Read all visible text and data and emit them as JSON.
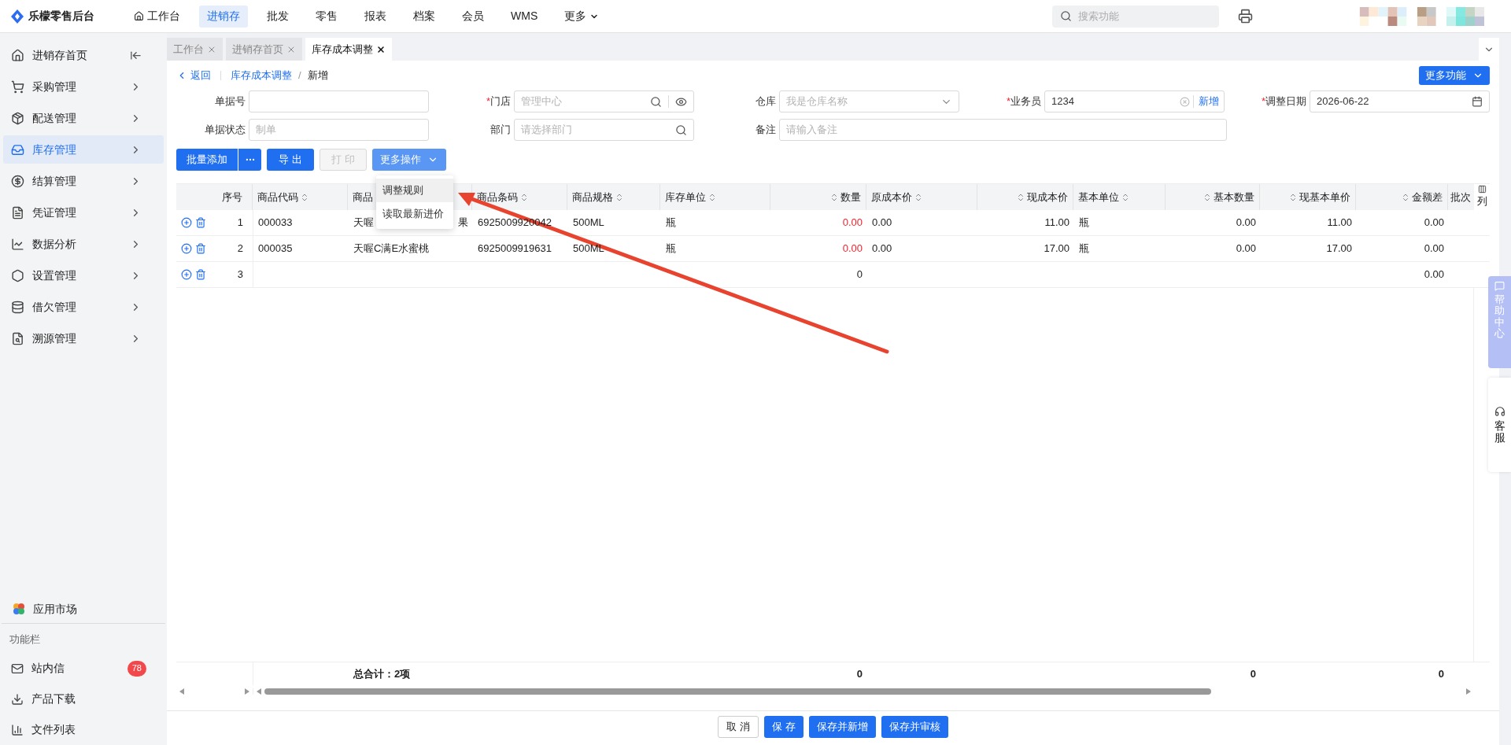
{
  "app": {
    "name": "乐檬零售后台"
  },
  "nav": [
    {
      "label": "工作台",
      "selected": false,
      "has_menu": false
    },
    {
      "label": "进销存",
      "selected": true,
      "has_menu": false
    },
    {
      "label": "批发",
      "selected": false,
      "has_menu": false
    },
    {
      "label": "零售",
      "selected": false,
      "has_menu": false
    },
    {
      "label": "报表",
      "selected": false,
      "has_menu": false
    },
    {
      "label": "档案",
      "selected": false,
      "has_menu": false
    },
    {
      "label": "会员",
      "selected": false,
      "has_menu": false
    },
    {
      "label": "WMS",
      "selected": false,
      "has_menu": false
    },
    {
      "label": "更多",
      "selected": false,
      "has_menu": true
    }
  ],
  "search": {
    "placeholder": "搜索功能"
  },
  "sidebar": {
    "items": [
      {
        "label": "进销存首页",
        "selected": false,
        "has_arrow": false
      },
      {
        "label": "采购管理",
        "selected": false,
        "has_arrow": true
      },
      {
        "label": "配送管理",
        "selected": false,
        "has_arrow": true
      },
      {
        "label": "库存管理",
        "selected": true,
        "has_arrow": true
      },
      {
        "label": "结算管理",
        "selected": false,
        "has_arrow": true
      },
      {
        "label": "凭证管理",
        "selected": false,
        "has_arrow": true
      },
      {
        "label": "数据分析",
        "selected": false,
        "has_arrow": true
      },
      {
        "label": "设置管理",
        "selected": false,
        "has_arrow": true
      },
      {
        "label": "借欠管理",
        "selected": false,
        "has_arrow": true
      },
      {
        "label": "溯源管理",
        "selected": false,
        "has_arrow": true
      }
    ],
    "app_market": "应用市场",
    "function_bar": {
      "title": "功能栏",
      "items": [
        {
          "label": "站内信",
          "badge": "78"
        },
        {
          "label": "产品下载"
        },
        {
          "label": "文件列表"
        }
      ]
    }
  },
  "tabs": [
    {
      "label": "工作台",
      "selected": false
    },
    {
      "label": "进销存首页",
      "selected": false
    },
    {
      "label": "库存成本调整",
      "selected": true
    }
  ],
  "breadcrumb": {
    "back": "返回",
    "separator": "/",
    "items": [
      "库存成本调整",
      "新增"
    ]
  },
  "more_functions": "更多功能",
  "form": {
    "required_mark": "*",
    "rows": [
      [
        {
          "label": "单据号",
          "required": false,
          "kind": "text"
        },
        {
          "label": "门店",
          "required": true,
          "kind": "search_eye",
          "placeholder": "管理中心"
        },
        {
          "label": "仓库",
          "required": false,
          "kind": "select",
          "placeholder": "我是仓库名称"
        },
        {
          "label": "业务员",
          "required": true,
          "kind": "staff",
          "value": "1234",
          "action": "新增"
        },
        {
          "label": "调整日期",
          "required": true,
          "kind": "date",
          "value": "2026-06-22"
        }
      ],
      [
        {
          "label": "单据状态",
          "required": false,
          "kind": "text",
          "placeholder": "制单"
        },
        {
          "label": "部门",
          "required": false,
          "kind": "search",
          "placeholder": "请选择部门"
        },
        {
          "label": "备注",
          "required": false,
          "kind": "wide",
          "placeholder": "请输入备注"
        }
      ]
    ]
  },
  "toolbar": [
    {
      "label": "批量添加",
      "kind": "split",
      "disabled": false
    },
    {
      "label": "导 出",
      "kind": "primary",
      "disabled": false
    },
    {
      "label": "打 印",
      "kind": "primary",
      "disabled": true
    },
    {
      "label": "更多操作",
      "kind": "dropdown",
      "disabled": false,
      "expanded": true,
      "menu": [
        {
          "label": "调整规则",
          "selected": true
        },
        {
          "label": "读取最新进价",
          "selected": false
        }
      ]
    }
  ],
  "table": {
    "index_header": "序号",
    "column_settings": "列",
    "columns": [
      {
        "label": "商品代码",
        "sortable": true,
        "kind": "text"
      },
      {
        "label": "商品",
        "sortable": false,
        "kind": "text"
      },
      {
        "label": "商品条码",
        "sortable": true,
        "kind": "text"
      },
      {
        "label": "商品规格",
        "sortable": true,
        "kind": "text"
      },
      {
        "label": "库存单位",
        "sortable": true,
        "kind": "text"
      },
      {
        "label": "数量",
        "sortable": true,
        "kind": "numeric"
      },
      {
        "label": "原成本价",
        "sortable": true,
        "kind": "text"
      },
      {
        "label": "现成本价",
        "sortable": true,
        "kind": "numeric"
      },
      {
        "label": "基本单位",
        "sortable": true,
        "kind": "text"
      },
      {
        "label": "基本数量",
        "sortable": true,
        "kind": "numeric"
      },
      {
        "label": "现基本单价",
        "sortable": true,
        "kind": "numeric"
      },
      {
        "label": "金额差",
        "sortable": true,
        "kind": "numeric"
      },
      {
        "label": "批次",
        "sortable": false,
        "kind": "text"
      }
    ],
    "rows": [
      {
        "index": "1",
        "qty_warning": true,
        "name_tail": "果",
        "cells": [
          "000033",
          "天喔",
          "6925009920042",
          "500ML",
          "瓶",
          "0.00",
          "0.00",
          "11.00",
          "瓶",
          "0.00",
          "11.00",
          "0.00"
        ]
      },
      {
        "index": "2",
        "qty_warning": true,
        "cells": [
          "000035",
          "天喔C满E水蜜桃",
          "6925009919631",
          "500ML",
          "瓶",
          "0.00",
          "0.00",
          "17.00",
          "瓶",
          "0.00",
          "17.00",
          "0.00"
        ]
      },
      {
        "index": "3",
        "qty_warning": false,
        "cells": [
          "",
          "",
          "",
          "",
          "",
          "0",
          "",
          "",
          "",
          "",
          "",
          "0.00"
        ]
      }
    ],
    "footer": {
      "total_label": "总合计：2项",
      "quantity": "0",
      "base_quantity": "0",
      "amount_difference": "0"
    }
  },
  "actions": [
    {
      "label": "取 消",
      "kind": "default"
    },
    {
      "label": "保 存",
      "kind": "primary"
    },
    {
      "label": "保存并新增",
      "kind": "primary"
    },
    {
      "label": "保存并审核",
      "kind": "primary"
    }
  ],
  "side_help": {
    "help_center": "帮助中心",
    "service": "客服"
  }
}
